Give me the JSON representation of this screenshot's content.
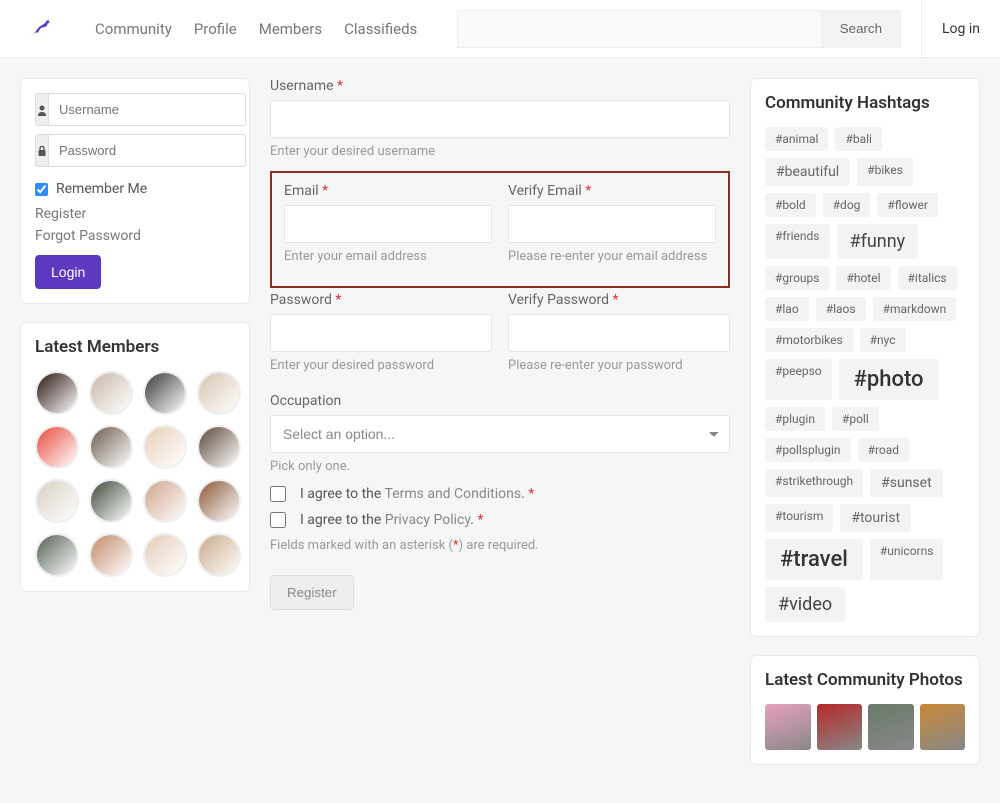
{
  "header": {
    "nav": [
      "Community",
      "Profile",
      "Members",
      "Classifieds"
    ],
    "search_placeholder": "",
    "search_button": "Search",
    "login": "Log in"
  },
  "login_box": {
    "username_ph": "Username",
    "password_ph": "Password",
    "remember": "Remember Me",
    "register": "Register",
    "forgot": "Forgot Password",
    "login_btn": "Login"
  },
  "latest_members": {
    "title": "Latest Members",
    "avatars": [
      "#2b1410",
      "#c9b8a8",
      "#3a3a3a",
      "#d8c5b0",
      "#e84c3d",
      "#6b5c4d",
      "#e8d0b8",
      "#5c483a",
      "#d8d0c4",
      "#3e4a3a",
      "#cfa68c",
      "#8a5838",
      "#556055",
      "#c48a6a",
      "#e4cdb8",
      "#c9a98a"
    ]
  },
  "form": {
    "username": {
      "label": "Username",
      "hint": "Enter your desired username"
    },
    "email": {
      "label": "Email",
      "hint": "Enter your email address"
    },
    "verify_email": {
      "label": "Verify Email",
      "hint": "Please re-enter your email address"
    },
    "password": {
      "label": "Password",
      "hint": "Enter your desired password"
    },
    "verify_password": {
      "label": "Verify Password",
      "hint": "Please re-enter your password"
    },
    "occupation": {
      "label": "Occupation",
      "placeholder": "Select an option...",
      "hint": "Pick only one."
    },
    "agree_prefix": "I agree to the ",
    "terms": "Terms and Conditions",
    "privacy": "Privacy Policy",
    "dot": ". ",
    "fields_note_pre": "Fields marked with an asterisk (",
    "fields_note_post": ") are required.",
    "register_btn": "Register"
  },
  "hashtags": {
    "title": "Community Hashtags",
    "tags": [
      {
        "t": "#animal",
        "s": 1
      },
      {
        "t": "#bali",
        "s": 1
      },
      {
        "t": "#beautiful",
        "s": 2
      },
      {
        "t": "#bikes",
        "s": 1
      },
      {
        "t": "#bold",
        "s": 1
      },
      {
        "t": "#dog",
        "s": 1
      },
      {
        "t": "#flower",
        "s": 1
      },
      {
        "t": "#friends",
        "s": 1
      },
      {
        "t": "#funny",
        "s": 3
      },
      {
        "t": "#groups",
        "s": 1
      },
      {
        "t": "#hotel",
        "s": 1
      },
      {
        "t": "#italics",
        "s": 1
      },
      {
        "t": "#lao",
        "s": 1
      },
      {
        "t": "#laos",
        "s": 1
      },
      {
        "t": "#markdown",
        "s": 1
      },
      {
        "t": "#motorbikes",
        "s": 1
      },
      {
        "t": "#nyc",
        "s": 1
      },
      {
        "t": "#peepso",
        "s": 1
      },
      {
        "t": "#photo",
        "s": 4
      },
      {
        "t": "#plugin",
        "s": 1
      },
      {
        "t": "#poll",
        "s": 1
      },
      {
        "t": "#pollsplugin",
        "s": 1
      },
      {
        "t": "#road",
        "s": 1
      },
      {
        "t": "#strikethrough",
        "s": 1
      },
      {
        "t": "#sunset",
        "s": 2
      },
      {
        "t": "#tourism",
        "s": 1
      },
      {
        "t": "#tourist",
        "s": 2
      },
      {
        "t": "#travel",
        "s": 4
      },
      {
        "t": "#unicorns",
        "s": 1
      },
      {
        "t": "#video",
        "s": 3
      }
    ]
  },
  "latest_photos": {
    "title": "Latest Community Photos",
    "photos": [
      "#e8a0c0",
      "#b82828",
      "#6a7a6a",
      "#c88838"
    ]
  }
}
